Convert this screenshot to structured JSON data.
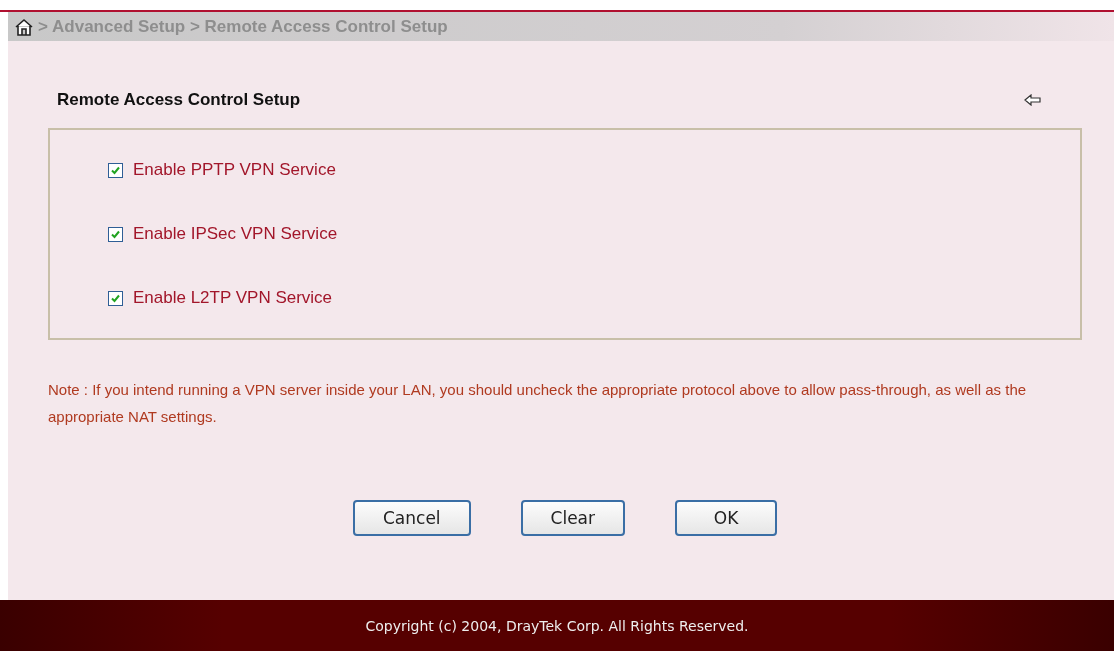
{
  "breadcrumb": "> Advanced Setup > Remote Access Control Setup",
  "title": "Remote Access Control Setup",
  "options": [
    {
      "label": "Enable PPTP VPN Service",
      "checked": true
    },
    {
      "label": "Enable IPSec VPN Service",
      "checked": true
    },
    {
      "label": "Enable L2TP VPN Service",
      "checked": true
    }
  ],
  "note": "Note : If you intend running a VPN server inside your LAN, you should uncheck the appropriate protocol above to allow pass-through, as well as the appropriate NAT settings.",
  "buttons": [
    "Cancel",
    "Clear",
    "OK"
  ],
  "footer": "Copyright (c) 2004, DrayTek Corp. All Rights Reserved."
}
